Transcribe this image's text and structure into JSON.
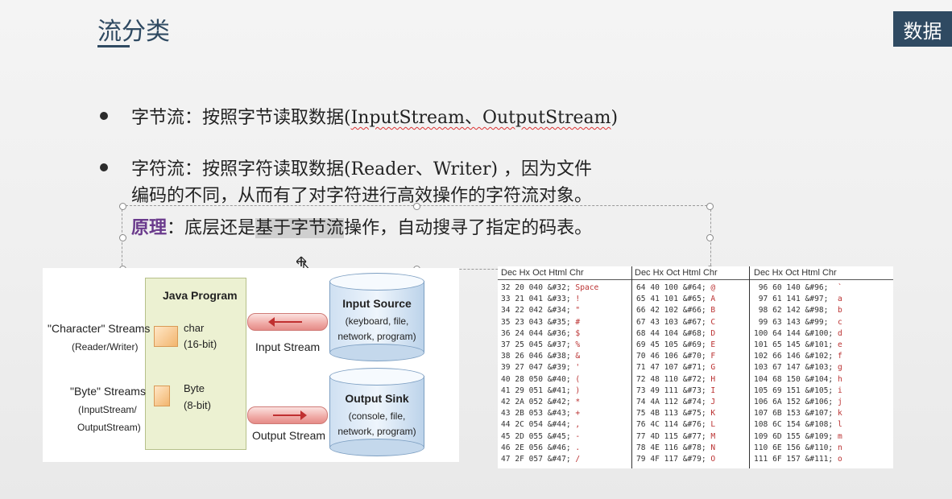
{
  "title": "流分类",
  "tag": "数据",
  "bullets": [
    {
      "prefix": "字节流：按照字节读取数据(",
      "code": "InputStream、OutputStream",
      "suffix": ")"
    },
    {
      "line1": "字符流：按照字符读取数据(Reader、Writer) ，因为文件",
      "line2": "编码的不同，从而有了对字符进行高效操作的字符流对象。"
    }
  ],
  "principle": {
    "label": "原理",
    "colon": "：",
    "pre": "底层还是",
    "highlight": "基于字节流",
    "post": "操作，自动搜寻了指定的码表。"
  },
  "diagram": {
    "java_program": "Java Program",
    "char_streams": "\"Character\" Streams",
    "char_streams_sub": "(Reader/Writer)",
    "byte_streams": "\"Byte\" Streams",
    "byte_streams_sub1": "(InputStream/",
    "byte_streams_sub2": "OutputStream)",
    "char_label1": "char",
    "char_label2": "(16-bit)",
    "byte_label1": "Byte",
    "byte_label2": "(8-bit)",
    "input_stream": "Input Stream",
    "output_stream": "Output Stream",
    "input_source_title": "Input Source",
    "input_source_l1": "(keyboard, file,",
    "input_source_l2": "network, program)",
    "output_sink_title": "Output Sink",
    "output_sink_l1": "(console, file,",
    "output_sink_l2": "network, program)"
  },
  "ascii_table": {
    "header": "Dec  Hx Oct  Html  Chr",
    "col1": [
      [
        "32 20 040 &#32; ",
        "Space"
      ],
      [
        "33 21 041 &#33; ",
        "!"
      ],
      [
        "34 22 042 &#34; ",
        "\""
      ],
      [
        "35 23 043 &#35; ",
        "#"
      ],
      [
        "36 24 044 &#36; ",
        "$"
      ],
      [
        "37 25 045 &#37; ",
        "%"
      ],
      [
        "38 26 046 &#38; ",
        "&"
      ],
      [
        "39 27 047 &#39; ",
        "'"
      ],
      [
        "40 28 050 &#40; ",
        "("
      ],
      [
        "41 29 051 &#41; ",
        ")"
      ],
      [
        "42 2A 052 &#42; ",
        "*"
      ],
      [
        "43 2B 053 &#43; ",
        "+"
      ],
      [
        "44 2C 054 &#44; ",
        ","
      ],
      [
        "45 2D 055 &#45; ",
        "-"
      ],
      [
        "46 2E 056 &#46; ",
        "."
      ],
      [
        "47 2F 057 &#47; ",
        "/"
      ]
    ],
    "col2": [
      [
        "64 40 100 &#64; ",
        "@"
      ],
      [
        "65 41 101 &#65; ",
        "A"
      ],
      [
        "66 42 102 &#66; ",
        "B"
      ],
      [
        "67 43 103 &#67; ",
        "C"
      ],
      [
        "68 44 104 &#68; ",
        "D"
      ],
      [
        "69 45 105 &#69; ",
        "E"
      ],
      [
        "70 46 106 &#70; ",
        "F"
      ],
      [
        "71 47 107 &#71; ",
        "G"
      ],
      [
        "72 48 110 &#72; ",
        "H"
      ],
      [
        "73 49 111 &#73; ",
        "I"
      ],
      [
        "74 4A 112 &#74; ",
        "J"
      ],
      [
        "75 4B 113 &#75; ",
        "K"
      ],
      [
        "76 4C 114 &#76; ",
        "L"
      ],
      [
        "77 4D 115 &#77; ",
        "M"
      ],
      [
        "78 4E 116 &#78; ",
        "N"
      ],
      [
        "79 4F 117 &#79; ",
        "O"
      ]
    ],
    "col3": [
      [
        " 96 60 140 &#96;  ",
        "`"
      ],
      [
        " 97 61 141 &#97;  ",
        "a"
      ],
      [
        " 98 62 142 &#98;  ",
        "b"
      ],
      [
        " 99 63 143 &#99;  ",
        "c"
      ],
      [
        "100 64 144 &#100; ",
        "d"
      ],
      [
        "101 65 145 &#101; ",
        "e"
      ],
      [
        "102 66 146 &#102; ",
        "f"
      ],
      [
        "103 67 147 &#103; ",
        "g"
      ],
      [
        "104 68 150 &#104; ",
        "h"
      ],
      [
        "105 69 151 &#105; ",
        "i"
      ],
      [
        "106 6A 152 &#106; ",
        "j"
      ],
      [
        "107 6B 153 &#107; ",
        "k"
      ],
      [
        "108 6C 154 &#108; ",
        "l"
      ],
      [
        "109 6D 155 &#109; ",
        "m"
      ],
      [
        "110 6E 156 &#110; ",
        "n"
      ],
      [
        "111 6F 157 &#111; ",
        "o"
      ]
    ]
  }
}
